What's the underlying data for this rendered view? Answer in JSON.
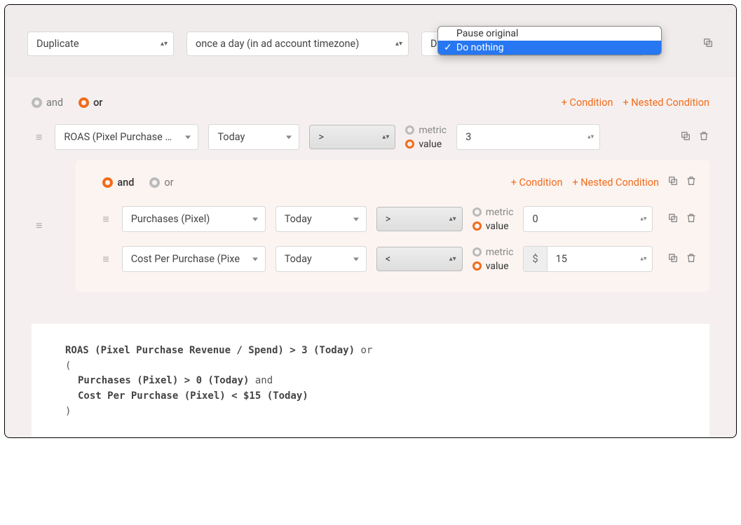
{
  "topbar": {
    "action": "Duplicate",
    "frequency": "once a day (in ad account timezone)",
    "postAction": "Do nothing",
    "dropdown": {
      "opt0": "Pause original",
      "opt1": "Do nothing"
    }
  },
  "labels": {
    "and": "and",
    "or": "or",
    "metric": "metric",
    "value": "value",
    "addCondition": "+ Condition",
    "addNested": "+ Nested Condition"
  },
  "outerGroup": {
    "logic": "or",
    "row1": {
      "metricField": "ROAS (Pixel Purchase Reve",
      "window": "Today",
      "op": ">",
      "mode": "value",
      "value": "3"
    }
  },
  "nestedGroup": {
    "logic": "and",
    "row1": {
      "metricField": "Purchases (Pixel)",
      "window": "Today",
      "op": ">",
      "mode": "value",
      "value": "0"
    },
    "row2": {
      "metricField": "Cost Per Purchase (Pixe",
      "window": "Today",
      "op": "<",
      "mode": "value",
      "prefix": "$",
      "value": "15"
    }
  },
  "summary": {
    "l1a": "ROAS (Pixel Purchase Revenue / Spend) > 3 (Today)",
    "l1b": " or",
    "l2": "(",
    "l3a": "Purchases (Pixel) > 0 (Today)",
    "l3b": " and",
    "l4": "Cost Per Purchase (Pixel) < $15 (Today)",
    "l5": ")"
  }
}
